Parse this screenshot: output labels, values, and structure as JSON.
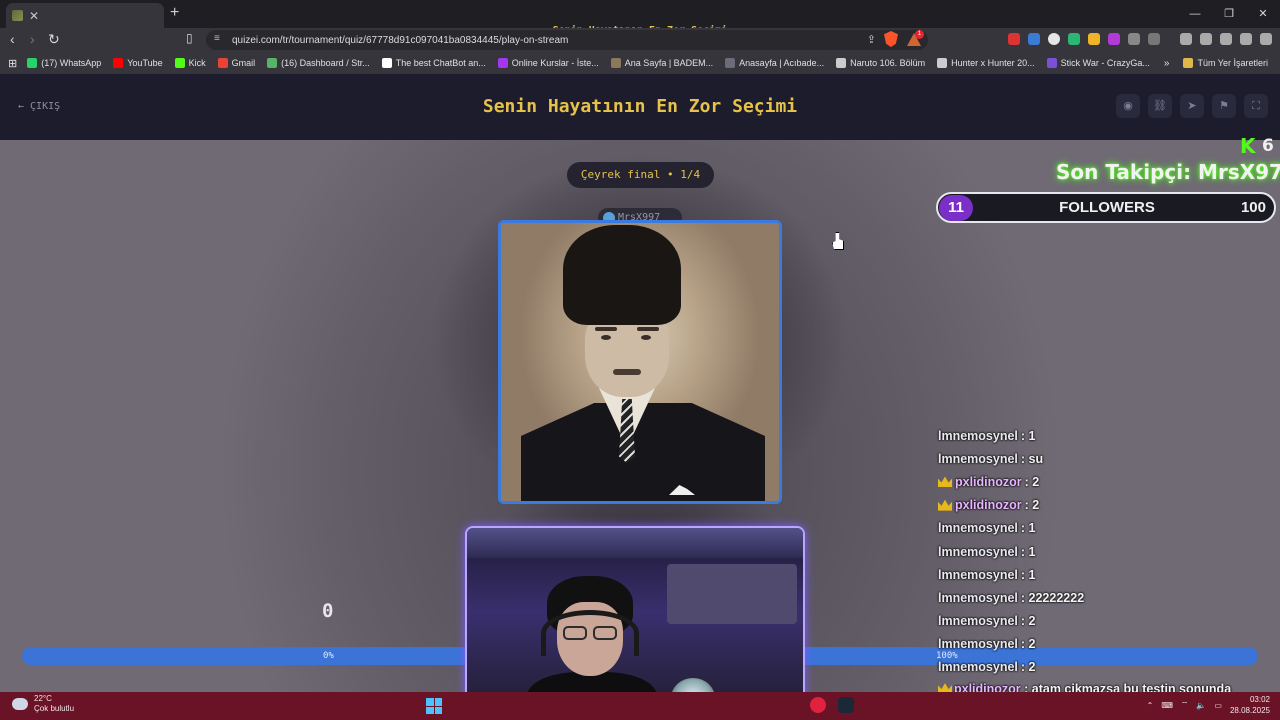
{
  "browser": {
    "tab_title": "Senin Hayatının En Zor Seçimi - ",
    "tab_close": "✕",
    "new_tab": "+",
    "url": "quizei.com/tr/tournament/quiz/67778d91c097041ba0834445/play-on-stream",
    "badge_count": "1",
    "window_controls": [
      "—",
      "❐",
      "✕"
    ],
    "bookmarks": [
      {
        "label": "(17) WhatsApp",
        "color": "#25d366"
      },
      {
        "label": "YouTube",
        "color": "#ff0000"
      },
      {
        "label": "Kick",
        "color": "#53fc18"
      },
      {
        "label": "Gmail",
        "color": "#ea4335"
      },
      {
        "label": "(16) Dashboard / Str...",
        "color": "#58b368"
      },
      {
        "label": "The best ChatBot an...",
        "color": "#ffffff"
      },
      {
        "label": "Online Kurslar - İste...",
        "color": "#a435f0"
      },
      {
        "label": "Ana Sayfa | BADEM...",
        "color": "#8a7a5a"
      },
      {
        "label": "Anasayfa | Acıbade...",
        "color": "#6b6b7a"
      },
      {
        "label": "Naruto 106. Bölüm",
        "color": "#cccccc"
      },
      {
        "label": "Hunter x Hunter 20...",
        "color": "#cccccc"
      },
      {
        "label": "Stick War - CrazyGa...",
        "color": "#7b4fd8"
      }
    ],
    "all_bookmarks": "Tüm Yer İşaretleri"
  },
  "page": {
    "exit_label": "ÇIKIŞ",
    "title": "Senin Hayatının En Zor Seçimi",
    "round_label": "Çeyrek final • 1/4",
    "author": "MrsX997",
    "vote_count": "0",
    "progress_left_label": "0%",
    "progress_right_label": "100%",
    "progress_value": 0
  },
  "overlay": {
    "kick_count": "6",
    "last_follower": "Son Takipçi: MrsX97",
    "followers_current": "11",
    "followers_label": "FOLLOWERS",
    "followers_goal": "100"
  },
  "chat": [
    {
      "name": "lmnemosynel",
      "text": " : 1",
      "vip": false
    },
    {
      "name": "lmnemosynel",
      "text": " : su",
      "vip": false
    },
    {
      "name": "pxlidinozor",
      "text": " : 2",
      "vip": true
    },
    {
      "name": "pxlidinozor",
      "text": " : 2",
      "vip": true
    },
    {
      "name": "lmnemosynel",
      "text": " : 1",
      "vip": false
    },
    {
      "name": "lmnemosynel",
      "text": " : 1",
      "vip": false
    },
    {
      "name": "lmnemosynel",
      "text": " : 1",
      "vip": false
    },
    {
      "name": "lmnemosynel",
      "text": " : 22222222",
      "vip": false
    },
    {
      "name": "lmnemosynel",
      "text": " : 2",
      "vip": false
    },
    {
      "name": "lmnemosynel",
      "text": " : 2",
      "vip": false
    },
    {
      "name": "lmnemosynel",
      "text": " : 2",
      "vip": false
    }
  ],
  "chat_last": {
    "name": "pxlidinozor",
    "text": " : atam cikmazsa bu testin sonunda gidiyom ben"
  },
  "taskbar": {
    "temperature": "22°C",
    "weather_desc": "Çok bulutlu",
    "time": "03:02",
    "date": "28.08.2025"
  }
}
